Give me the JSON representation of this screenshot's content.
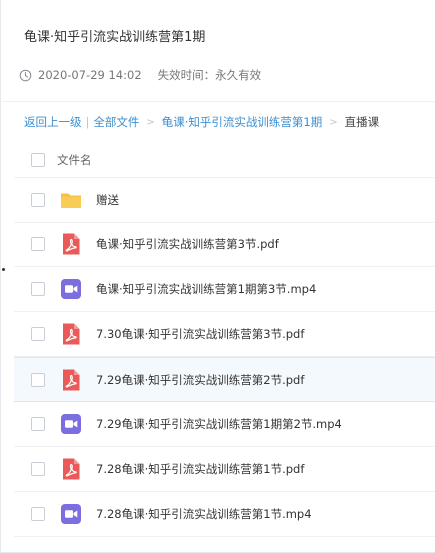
{
  "page": {
    "title": "龟课·知乎引流实战训练营第1期",
    "date": "2020-07-29 14:02",
    "validity": "失效时间：永久有效"
  },
  "breadcrumb": {
    "back": "返回上一级",
    "separator": "|",
    "all_files": "全部文件",
    "folder": "龟课·知乎引流实战训练营第1期",
    "current": "直播课"
  },
  "list": {
    "header": "文件名",
    "items": [
      {
        "name": "赠送",
        "type": "folder"
      },
      {
        "name": "龟课·知乎引流实战训练营第3节.pdf",
        "type": "pdf"
      },
      {
        "name": "龟课·知乎引流实战训练营第1期第3节.mp4",
        "type": "video"
      },
      {
        "name": "7.30龟课·知乎引流实战训练营第3节.pdf",
        "type": "pdf"
      },
      {
        "name": "7.29龟课·知乎引流实战训练营第2节.pdf",
        "type": "pdf"
      },
      {
        "name": "7.29龟课·知乎引流实战训练营第1期第2节.mp4",
        "type": "video"
      },
      {
        "name": "7.28龟课·知乎引流实战训练营第1节.pdf",
        "type": "pdf"
      },
      {
        "name": "7.28龟课·知乎引流实战训练营第1节.mp4",
        "type": "video"
      }
    ]
  },
  "colors": {
    "link": "#3b8ed0",
    "folder": "#f7c244",
    "pdf": "#e95a59",
    "video": "#7b6fe0"
  }
}
